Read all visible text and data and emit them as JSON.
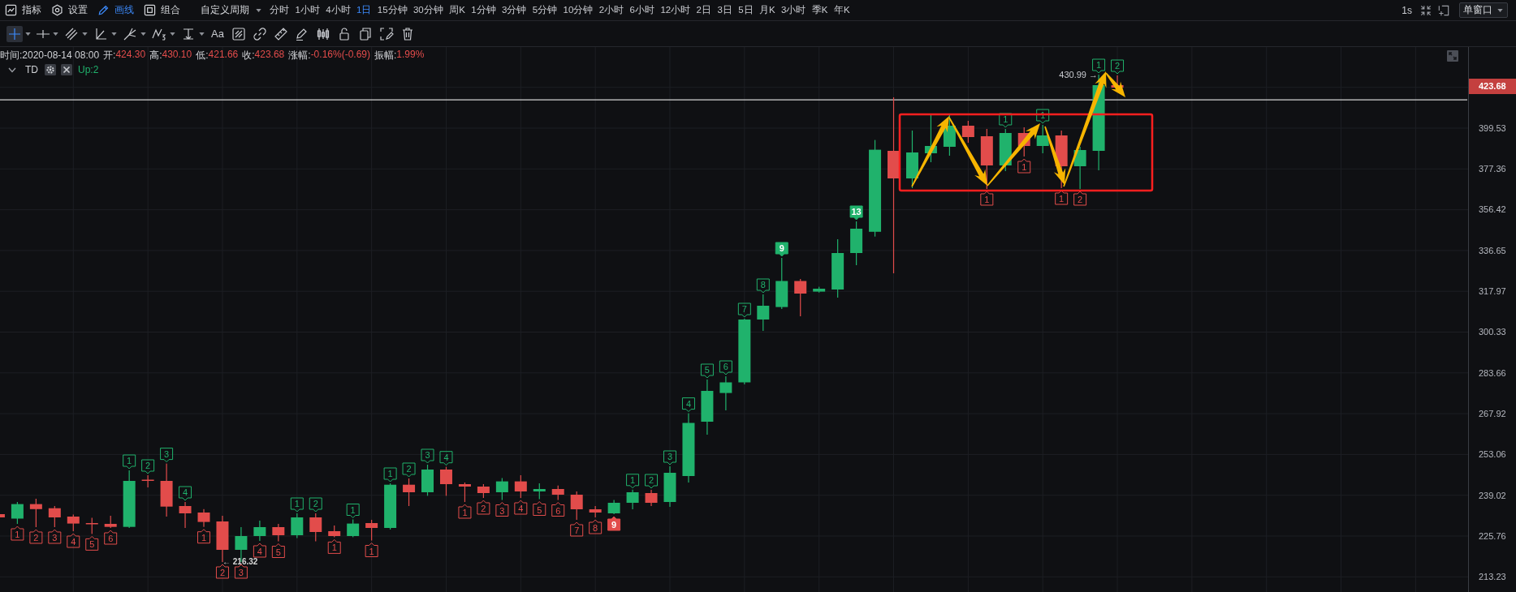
{
  "toolbar": {
    "items": [
      {
        "label": "指标",
        "selected": false
      },
      {
        "label": "设置",
        "selected": false
      },
      {
        "label": "画线",
        "selected": true
      },
      {
        "label": "组合",
        "selected": false
      }
    ],
    "period_menu": "自定义周期",
    "periods": [
      {
        "label": "分时",
        "selected": false
      },
      {
        "label": "1小时",
        "selected": false
      },
      {
        "label": "4小时",
        "selected": false
      },
      {
        "label": "1日",
        "selected": true
      },
      {
        "label": "15分钟",
        "selected": false
      },
      {
        "label": "30分钟",
        "selected": false
      },
      {
        "label": "周K",
        "selected": false
      },
      {
        "label": "1分钟",
        "selected": false
      },
      {
        "label": "3分钟",
        "selected": false
      },
      {
        "label": "5分钟",
        "selected": false
      },
      {
        "label": "10分钟",
        "selected": false
      },
      {
        "label": "2小时",
        "selected": false
      },
      {
        "label": "6小时",
        "selected": false
      },
      {
        "label": "12小时",
        "selected": false
      },
      {
        "label": "2日",
        "selected": false
      },
      {
        "label": "3日",
        "selected": false
      },
      {
        "label": "5日",
        "selected": false
      },
      {
        "label": "月K",
        "selected": false
      },
      {
        "label": "3小时",
        "selected": false
      },
      {
        "label": "季K",
        "selected": false
      },
      {
        "label": "年K",
        "selected": false
      }
    ],
    "refresh_interval": "1s",
    "window_mode": "单窗口"
  },
  "drawing_tools": [
    {
      "selected": true,
      "menu": true
    },
    {
      "selected": false,
      "menu": true
    },
    {
      "selected": false,
      "menu": true
    },
    {
      "selected": false,
      "menu": true
    },
    {
      "selected": false,
      "menu": true
    },
    {
      "selected": false,
      "menu": true
    },
    {
      "selected": false,
      "menu": true
    },
    {
      "label": "Aa",
      "selected": false,
      "menu": false
    },
    {
      "selected": false,
      "menu": false
    },
    {
      "selected": false,
      "menu": false
    },
    {
      "selected": false,
      "menu": false
    },
    {
      "selected": false,
      "menu": false
    },
    {
      "selected": false,
      "menu": false
    },
    {
      "selected": false,
      "menu": false
    },
    {
      "selected": false,
      "menu": false
    },
    {
      "selected": false,
      "menu": false
    },
    {
      "selected": false,
      "menu": false
    }
  ],
  "legend": {
    "time": "时间:2020-08-14 08:00",
    "fields": [
      {
        "label": "开:",
        "value": "424.30"
      },
      {
        "label": "高:",
        "value": "430.10"
      },
      {
        "label": "低:",
        "value": "421.66"
      },
      {
        "label": "收:",
        "value": "423.68"
      },
      {
        "label": "涨幅:",
        "value": "-0.16%(-0.69)"
      },
      {
        "label": "振幅:",
        "value": "1.99%"
      }
    ],
    "indicator": {
      "name": "TD",
      "value": "Up:2"
    }
  },
  "chart": {
    "high_label": "430.99 →",
    "low_label": "← 216.32",
    "td_marks": [
      {
        "label": "1",
        "kind": "below",
        "filled": false
      },
      {
        "label": "2",
        "kind": "below",
        "filled": false
      },
      {
        "label": "3",
        "kind": "below",
        "filled": false
      },
      {
        "label": "4",
        "kind": "below",
        "filled": false
      },
      {
        "label": "5",
        "kind": "below",
        "filled": false
      },
      {
        "label": "6",
        "kind": "below",
        "filled": false
      },
      {
        "label": "1",
        "kind": "above",
        "filled": false
      },
      {
        "label": "2",
        "kind": "above",
        "filled": false
      },
      {
        "label": "3",
        "kind": "above",
        "filled": false
      },
      {
        "label": "4",
        "kind": "above",
        "filled": false
      },
      {
        "label": "1",
        "kind": "below",
        "filled": false
      },
      {
        "label": "2",
        "kind": "below",
        "filled": false
      },
      {
        "label": "3",
        "kind": "below",
        "filled": false
      },
      {
        "label": "4",
        "kind": "below",
        "filled": false
      },
      {
        "label": "5",
        "kind": "below",
        "filled": false
      },
      {
        "label": "1",
        "kind": "above",
        "filled": false
      },
      {
        "label": "2",
        "kind": "above",
        "filled": false
      },
      {
        "label": "1",
        "kind": "below",
        "filled": false
      },
      {
        "label": "1",
        "kind": "above",
        "filled": false
      },
      {
        "label": "1",
        "kind": "below",
        "filled": false
      },
      {
        "label": "1",
        "kind": "above",
        "filled": false
      },
      {
        "label": "2",
        "kind": "above",
        "filled": false
      },
      {
        "label": "3",
        "kind": "above",
        "filled": false
      },
      {
        "label": "4",
        "kind": "above",
        "filled": false
      },
      {
        "label": "1",
        "kind": "below",
        "filled": false
      },
      {
        "label": "2",
        "kind": "below",
        "filled": false
      },
      {
        "label": "3",
        "kind": "below",
        "filled": false
      },
      {
        "label": "4",
        "kind": "below",
        "filled": false
      },
      {
        "label": "5",
        "kind": "below",
        "filled": false
      },
      {
        "label": "6",
        "kind": "below",
        "filled": false
      },
      {
        "label": "7",
        "kind": "below",
        "filled": false
      },
      {
        "label": "8",
        "kind": "below",
        "filled": false
      },
      {
        "label": "9",
        "kind": "below",
        "filled": true
      },
      {
        "label": "1",
        "kind": "above",
        "filled": false
      },
      {
        "label": "2",
        "kind": "above",
        "filled": false
      },
      {
        "label": "3",
        "kind": "above",
        "filled": false
      },
      {
        "label": "4",
        "kind": "above",
        "filled": false
      },
      {
        "label": "5",
        "kind": "above",
        "filled": false
      },
      {
        "label": "6",
        "kind": "above",
        "filled": false
      },
      {
        "label": "7",
        "kind": "above",
        "filled": false
      },
      {
        "label": "8",
        "kind": "above",
        "filled": false
      },
      {
        "label": "9",
        "kind": "above",
        "filled": true
      },
      {
        "label": "13",
        "kind": "above",
        "filled": true
      },
      {
        "label": "1",
        "kind": "below",
        "filled": false
      },
      {
        "label": "1",
        "kind": "above",
        "filled": false
      },
      {
        "label": "1",
        "kind": "below",
        "filled": false
      },
      {
        "label": "1",
        "kind": "above",
        "filled": false
      },
      {
        "label": "1",
        "kind": "below",
        "filled": false
      },
      {
        "label": "2",
        "kind": "below",
        "filled": false
      },
      {
        "label": "1",
        "kind": "above",
        "filled": false
      },
      {
        "label": "2",
        "kind": "above",
        "filled": false
      }
    ],
    "price_axis": {
      "last_price": "423.68",
      "ticks": [
        "399.53",
        "377.36",
        "356.42",
        "336.65",
        "317.97",
        "300.33",
        "283.66",
        "267.92",
        "253.06",
        "239.02",
        "225.76",
        "213.23"
      ]
    }
  }
}
